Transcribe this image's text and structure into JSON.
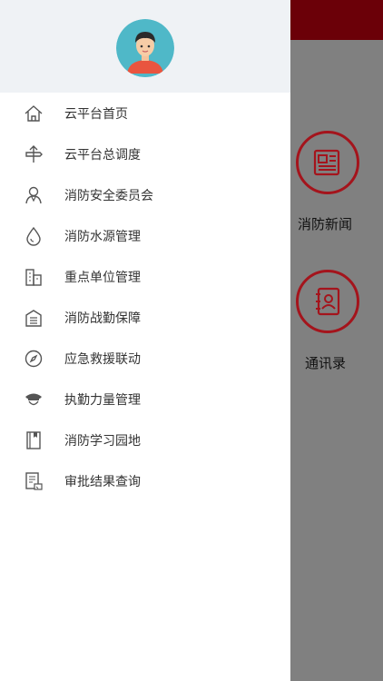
{
  "drawer": {
    "menu": [
      {
        "label": "云平台首页",
        "icon": "home-icon"
      },
      {
        "label": "云平台总调度",
        "icon": "dispatch-icon"
      },
      {
        "label": "消防安全委员会",
        "icon": "person-icon"
      },
      {
        "label": "消防水源管理",
        "icon": "water-drop-icon"
      },
      {
        "label": "重点单位管理",
        "icon": "building-icon"
      },
      {
        "label": "消防战勤保障",
        "icon": "supply-icon"
      },
      {
        "label": "应急救援联动",
        "icon": "compass-icon"
      },
      {
        "label": "执勤力量管理",
        "icon": "police-cap-icon"
      },
      {
        "label": "消防学习园地",
        "icon": "book-icon"
      },
      {
        "label": "审批结果查询",
        "icon": "document-check-icon"
      }
    ]
  },
  "background": {
    "news_label": "消防新闻",
    "contacts_label": "通讯录"
  },
  "colors": {
    "drawer_header_bg": "#eff2f5",
    "overlay": "#808080",
    "topbar": "#6b0008",
    "accent_red": "#a4141c",
    "avatar_bg": "#4fb8c8",
    "avatar_shirt": "#e9553f"
  }
}
